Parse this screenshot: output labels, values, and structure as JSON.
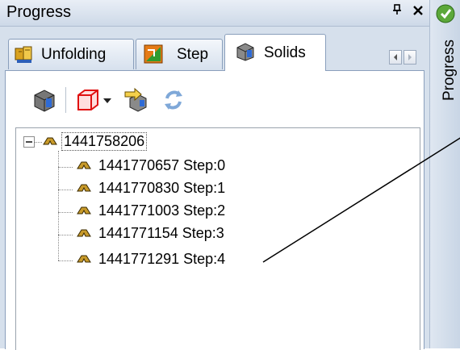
{
  "panel": {
    "title": "Progress",
    "pin_label": "⭦",
    "close_label": "✖"
  },
  "tabs": [
    {
      "label": "Unfolding",
      "icon": "unfolding-icon",
      "active": false
    },
    {
      "label": "Step",
      "icon": "step-icon",
      "active": false
    },
    {
      "label": "Solids",
      "icon": "solids-icon",
      "active": true
    }
  ],
  "toolbar": {
    "icons": [
      "solid-model-icon",
      "red-cube-dropdown-icon",
      "import-solid-icon",
      "refresh-icon"
    ]
  },
  "tree": {
    "root": {
      "label": "1441758206",
      "expanded": true
    },
    "children": [
      {
        "label": "1441770657 Step:0"
      },
      {
        "label": "1441770830 Step:1"
      },
      {
        "label": "1441771003 Step:2"
      },
      {
        "label": "1441771154 Step:3"
      },
      {
        "label": "1441771291 Step:4"
      }
    ]
  },
  "side_tab": {
    "label": "Progress",
    "icon": "progress-clock-icon"
  },
  "colors": {
    "accent": "#8a9fbc",
    "panel_bg": "#d6e0ec",
    "node_icon": "#c89a2a"
  }
}
